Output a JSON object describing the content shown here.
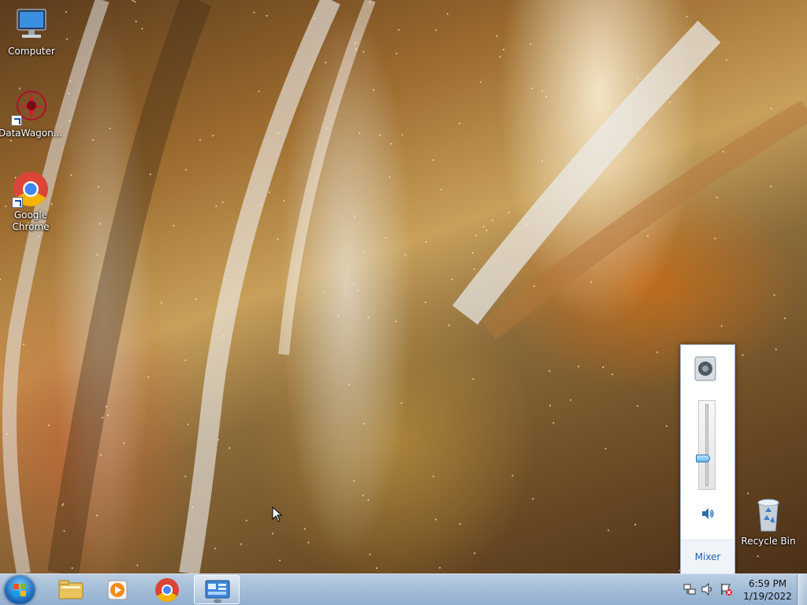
{
  "desktop": {
    "icons": [
      {
        "label": "Computer"
      },
      {
        "label": "DataWagon..."
      },
      {
        "label": "Google Chrome"
      },
      {
        "label": "Recycle Bin"
      }
    ]
  },
  "volume_popup": {
    "level": 0.33,
    "mixer_label": "Mixer"
  },
  "taskbar": {
    "buttons": [
      {
        "icon": "windows-explorer-icon"
      },
      {
        "icon": "media-player-icon"
      },
      {
        "icon": "chrome-icon"
      },
      {
        "icon": "remote-app-icon",
        "active": true
      }
    ],
    "clock": {
      "time": "6:59 PM",
      "date": "1/19/2022"
    }
  }
}
